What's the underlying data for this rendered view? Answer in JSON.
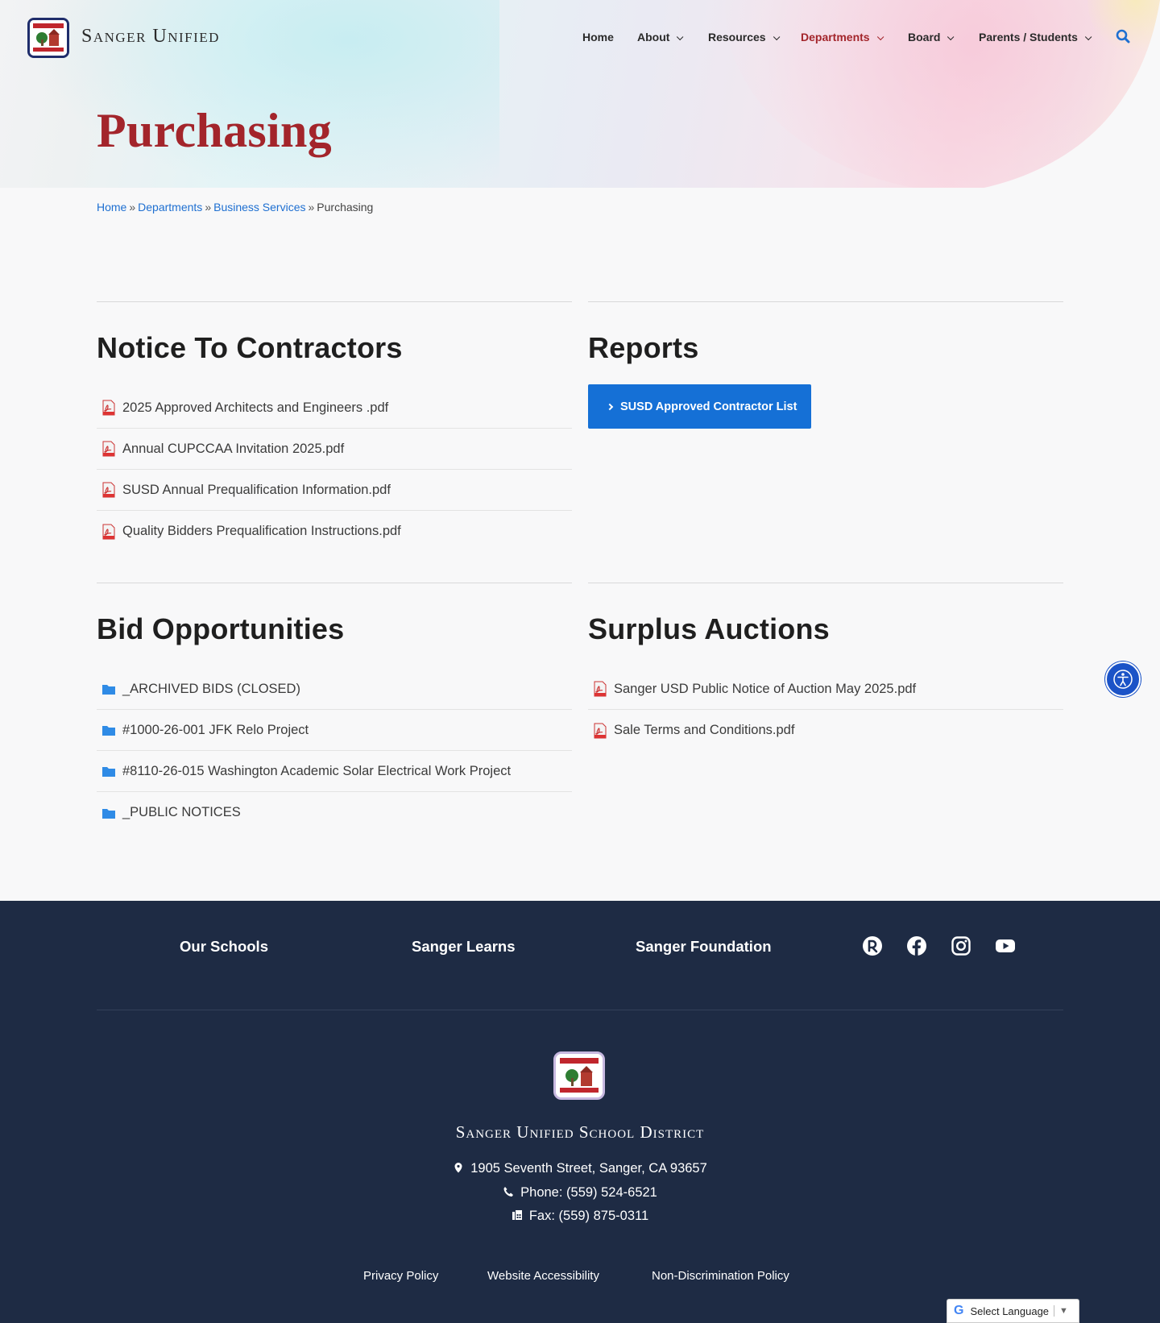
{
  "brand": {
    "name": "Sanger Unified"
  },
  "nav": {
    "items": [
      {
        "label": "Home"
      },
      {
        "label": "About"
      },
      {
        "label": "Resources"
      },
      {
        "label": "Departments"
      },
      {
        "label": "Board"
      },
      {
        "label": "Parents / Students"
      }
    ],
    "active": "Departments"
  },
  "page": {
    "title": "Purchasing"
  },
  "breadcrumb": {
    "items": [
      "Home",
      "Departments",
      "Business Services"
    ],
    "current": "Purchasing",
    "separator": "»"
  },
  "sections": {
    "notice": {
      "title": "Notice To Contractors",
      "files": [
        "2025 Approved Architects and Engineers .pdf",
        "Annual CUPCCAA Invitation 2025.pdf",
        "SUSD Annual Prequalification Information.pdf",
        "Quality Bidders Prequalification Instructions.pdf"
      ]
    },
    "reports": {
      "title": "Reports",
      "button_label": "SUSD Approved Contractor List"
    },
    "bids": {
      "title": "Bid Opportunities",
      "folders": [
        "_ARCHIVED BIDS (CLOSED)",
        "#1000-26-001 JFK Relo Project",
        "#8110-26-015 Washington Academic Solar Electrical Work Project",
        "_PUBLIC NOTICES"
      ]
    },
    "surplus": {
      "title": "Surplus Auctions",
      "files": [
        "Sanger USD Public Notice of Auction May 2025.pdf",
        "Sale Terms and Conditions.pdf"
      ]
    }
  },
  "footer": {
    "links": [
      "Our Schools",
      "Sanger Learns",
      "Sanger Foundation"
    ],
    "social_icons": [
      "rooms-app-icon",
      "facebook-icon",
      "instagram-icon",
      "youtube-icon"
    ],
    "district": "Sanger Unified School District",
    "address": "1905 Seventh Street, Sanger, CA 93657",
    "phone": "Phone: (559) 524-6521",
    "fax": "Fax: (559) 875-0311",
    "legal": [
      "Privacy Policy",
      "Website Accessibility",
      "Non-Discrimination Policy"
    ]
  },
  "translate": {
    "label": "Select Language"
  },
  "colors": {
    "accent_red": "#a3252b",
    "link_blue": "#1e6fd1",
    "button_blue": "#1570d6",
    "footer_navy": "#1e2b44",
    "folder_blue": "#2f8be6"
  }
}
